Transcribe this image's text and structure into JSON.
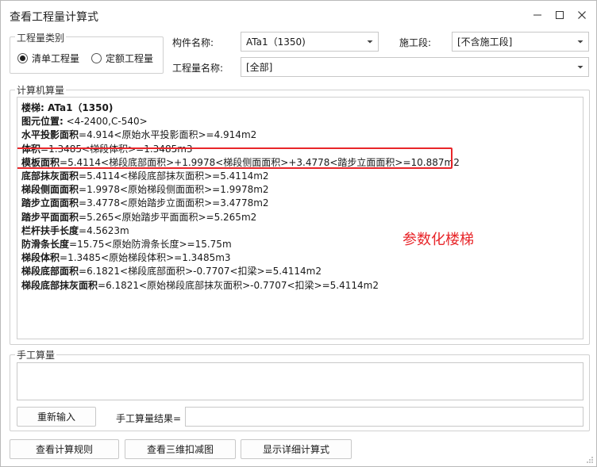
{
  "window": {
    "title": "查看工程量计算式"
  },
  "qty_category": {
    "legend": "工程量类别",
    "options": [
      {
        "label": "清单工程量",
        "selected": true
      },
      {
        "label": "定额工程量",
        "selected": false
      }
    ]
  },
  "filters": {
    "component_label": "构件名称:",
    "component_value": "ATa1（1350)",
    "segment_label": "施工段:",
    "segment_value": "[不含施工段]",
    "qty_name_label": "工程量名称:",
    "qty_name_value": "[全部]"
  },
  "computer_calc": {
    "legend": "计算机算量",
    "lines": [
      {
        "key": "楼梯: ATa1（1350)",
        "rest": ""
      },
      {
        "key": "图元位置:",
        "rest": " <4-2400,C-540>"
      },
      {
        "key": "水平投影面积",
        "rest": "=4.914<原始水平投影面积>=4.914m2"
      },
      {
        "key": "体积",
        "rest": "=1.3485<梯段体积>=1.3485m3"
      },
      {
        "key": "模板面积",
        "rest": "=5.4114<梯段底部面积>+1.9978<梯段侧面面积>+3.4778<踏步立面面积>=10.887m2"
      },
      {
        "key": "底部抹灰面积",
        "rest": "=5.4114<梯段底部抹灰面积>=5.4114m2"
      },
      {
        "key": "梯段侧面面积",
        "rest": "=1.9978<原始梯段侧面面积>=1.9978m2"
      },
      {
        "key": "踏步立面面积",
        "rest": "=3.4778<原始踏步立面面积>=3.4778m2"
      },
      {
        "key": "踏步平面面积",
        "rest": "=5.265<原始踏步平面面积>=5.265m2"
      },
      {
        "key": "栏杆扶手长度",
        "rest": "=4.5623m"
      },
      {
        "key": "防滑条长度",
        "rest": "=15.75<原始防滑条长度>=15.75m"
      },
      {
        "key": "梯段体积",
        "rest": "=1.3485<原始梯段体积>=1.3485m3"
      },
      {
        "key": "梯段底部面积",
        "rest": "=6.1821<梯段底部面积>-0.7707<扣梁>=5.4114m2"
      },
      {
        "key": "梯段底部抹灰面积",
        "rest": "=6.1821<原始梯段底部抹灰面积>-0.7707<扣梁>=5.4114m2"
      }
    ],
    "annotation": "参数化楼梯",
    "highlight_color": "#e8262a"
  },
  "manual_calc": {
    "legend": "手工算量",
    "reenter_button": "重新输入",
    "result_label": "手工算量结果="
  },
  "footer": {
    "view_rules": "查看计算规则",
    "view_3d": "查看三维扣减图",
    "show_detail": "显示详细计算式"
  }
}
